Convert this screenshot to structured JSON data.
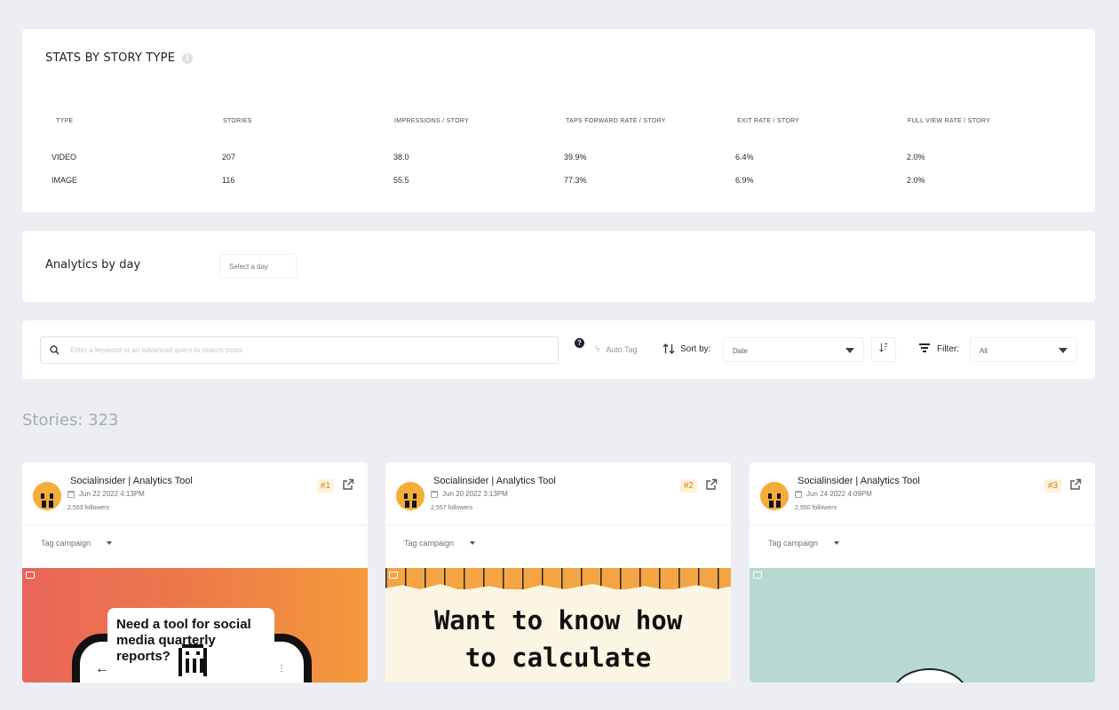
{
  "stats": {
    "title": "STATS BY STORY TYPE",
    "columns": [
      "TYPE",
      "STORIES",
      "IMPRESSIONS / STORY",
      "TAPS FORWARD RATE / STORY",
      "EXIT RATE / STORY",
      "FULL VIEW RATE / STORY"
    ],
    "rows": [
      [
        "VIDEO",
        "207",
        "38.0",
        "39.9%",
        "6.4%",
        "2.0%"
      ],
      [
        "IMAGE",
        "116",
        "55.5",
        "77.3%",
        "6.9%",
        "2.0%"
      ]
    ]
  },
  "analytics_by_day": {
    "title": "Analytics by day",
    "select_placeholder": "Select a day"
  },
  "toolbar": {
    "search_placeholder": "Enter a keyword or an advanced query to search posts",
    "help_glyph": "?",
    "auto_tag": "Auto Tag",
    "sort_label": "Sort by:",
    "sort_value": "Date",
    "filter_label": "Filter:",
    "filter_value": "All"
  },
  "stories_count": "Stories: 323",
  "stories": [
    {
      "account": "Socialinsider | Analytics Tool",
      "date": "Jun 22 2022 4:13PM",
      "followers": "2,553 followers",
      "rank": "#1",
      "tag_campaign": "Tag campaign",
      "preview_text": "Need a tool for social media quarterly reports?"
    },
    {
      "account": "Socialinsider | Analytics Tool",
      "date": "Jun 20 2022 3:13PM",
      "followers": "2,557 followers",
      "rank": "#2",
      "tag_campaign": "Tag campaign",
      "preview_text_line1": "Want to know how",
      "preview_text_line2": "to calculate"
    },
    {
      "account": "Socialinsider | Analytics Tool",
      "date": "Jun 24 2022 4:09PM",
      "followers": "2,550 followers",
      "rank": "#3",
      "tag_campaign": "Tag campaign"
    }
  ],
  "colors": {
    "background": "#eceef3",
    "avatar": "#f5ac3a",
    "rank_bg": "#fdf1d9",
    "rank_text": "#c98b1c",
    "thumb3": "#b7d9d1"
  },
  "icons": [
    "info-icon",
    "search-icon",
    "help-icon",
    "bolt-icon",
    "sort-arrows-icon",
    "sort-order-icon",
    "filter-icon",
    "calendar-icon",
    "external-link-icon",
    "image-type-icon",
    "chevron-down-icon"
  ]
}
